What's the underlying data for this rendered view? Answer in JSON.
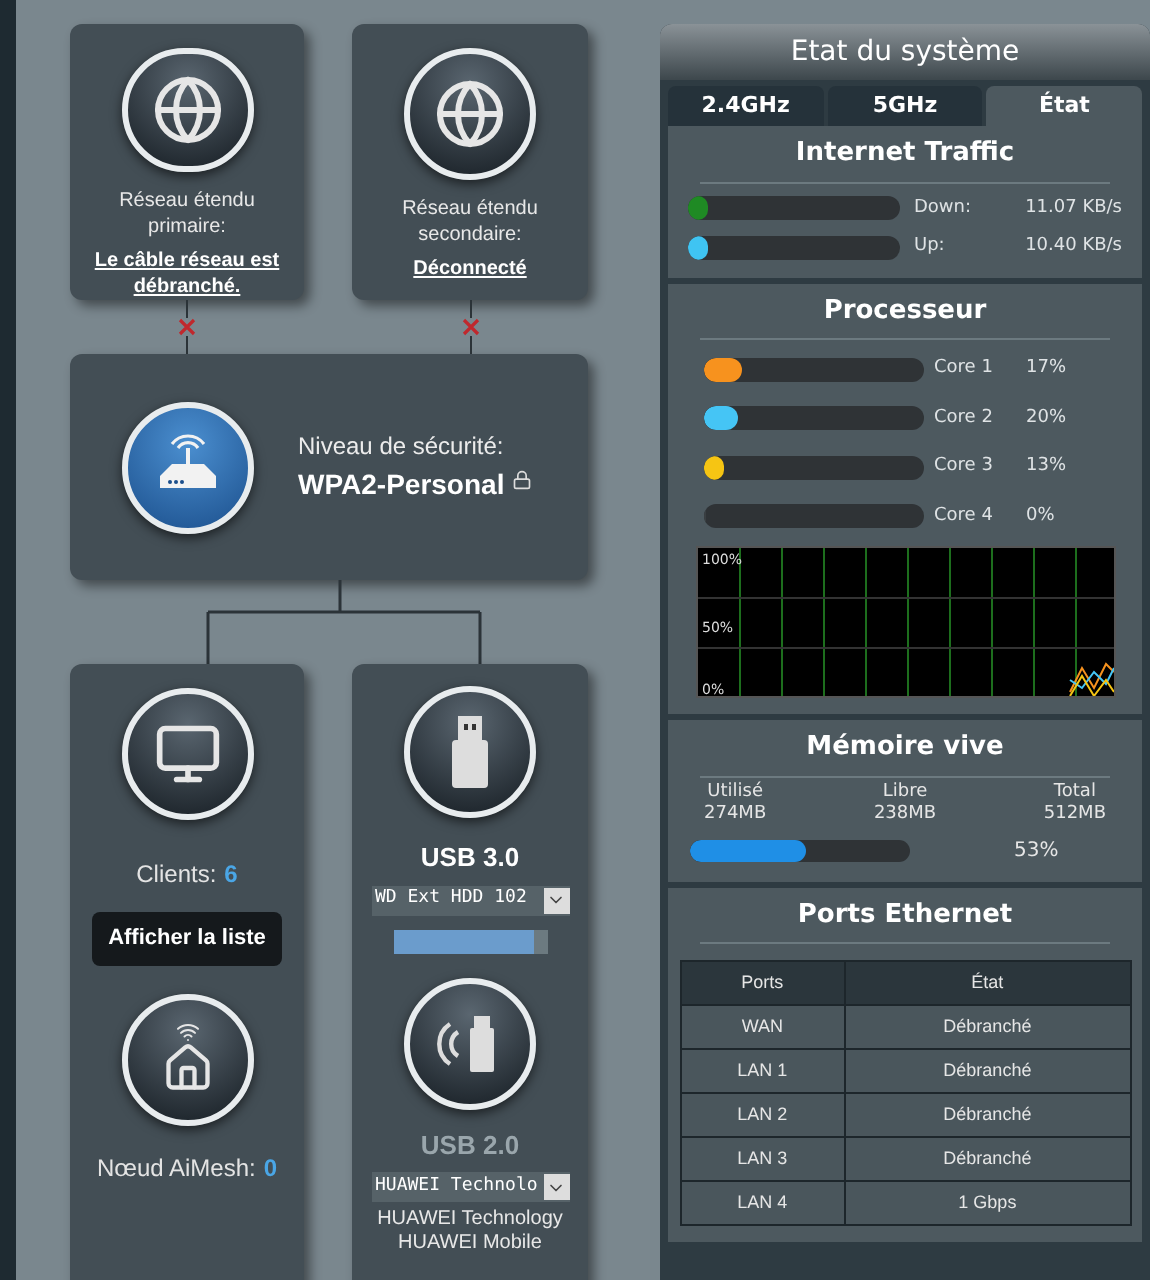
{
  "wan_primary": {
    "label": "Réseau étendu primaire:",
    "status": "Le câble réseau est débranché.",
    "connected": false
  },
  "wan_secondary": {
    "label": "Réseau étendu secondaire:",
    "status": "Déconnecté",
    "connected": false
  },
  "router": {
    "label": "Niveau de sécurité:",
    "security": "WPA2-Personal"
  },
  "clients": {
    "label": "Clients:",
    "count": "6",
    "button": "Afficher la liste"
  },
  "aimesh": {
    "label": "Nœud AiMesh:",
    "count": "0"
  },
  "usb3": {
    "title": "USB 3.0",
    "device": "WD Ext HDD 102",
    "level": 0.91
  },
  "usb2": {
    "title": "USB 2.0",
    "device": "HUAWEI Technolo",
    "description": [
      "HUAWEI Technology",
      "HUAWEI Mobile"
    ]
  },
  "panel": {
    "title": "Etat du système",
    "tabs": [
      {
        "label": "2.4GHz",
        "selected": false
      },
      {
        "label": "5GHz",
        "selected": false
      },
      {
        "label": "État",
        "selected": true
      }
    ],
    "traffic": {
      "title": "Internet Traffic",
      "rows": [
        {
          "label": "Down:",
          "value": "11.07 KB/s",
          "color": "#1f8a24",
          "level": 0.02
        },
        {
          "label": "Up:",
          "value": "10.40 KB/s",
          "color": "#3fc4f2",
          "level": 0.02
        }
      ]
    },
    "cpu": {
      "title": "Processeur",
      "cores": [
        {
          "label": "Core 1",
          "value": "17%",
          "color": "#f7921e",
          "level": 0.17
        },
        {
          "label": "Core 2",
          "value": "20%",
          "color": "#45c5f5",
          "level": 0.15
        },
        {
          "label": "Core 3",
          "value": "13%",
          "color": "#f6c513",
          "level": 0.08
        },
        {
          "label": "Core 4",
          "value": "0%",
          "level": 0
        }
      ],
      "graph_labels": [
        "100%",
        "50%",
        "0%"
      ]
    },
    "memory": {
      "title": "Mémoire vive",
      "stats": [
        {
          "label": "Utilisé",
          "value": "274MB"
        },
        {
          "label": "Libre",
          "value": "238MB"
        },
        {
          "label": "Total",
          "value": "512MB"
        }
      ],
      "level": 0.53,
      "percent": "53%"
    },
    "ports": {
      "title": "Ports Ethernet",
      "columns": [
        "Ports",
        "État"
      ],
      "rows": [
        [
          "WAN",
          "Débranché"
        ],
        [
          "LAN 1",
          "Débranché"
        ],
        [
          "LAN 2",
          "Débranché"
        ],
        [
          "LAN 3",
          "Débranché"
        ],
        [
          "LAN 4",
          "1 Gbps"
        ]
      ]
    }
  }
}
